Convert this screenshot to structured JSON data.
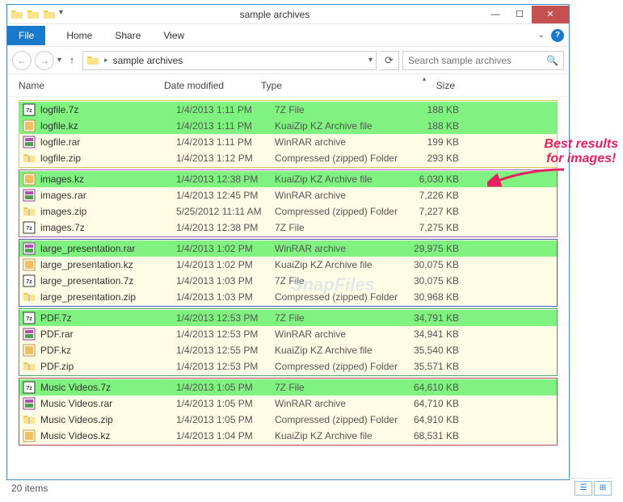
{
  "window": {
    "title": "sample archives"
  },
  "ribbon": {
    "file": "File",
    "home": "Home",
    "share": "Share",
    "view": "View"
  },
  "breadcrumb": {
    "current": "sample archives"
  },
  "search": {
    "placeholder": "Search sample archives"
  },
  "columns": {
    "name": "Name",
    "date": "Date modified",
    "type": "Type",
    "size": "Size"
  },
  "groups": [
    {
      "cls": "grp-yellow",
      "rows": [
        {
          "hl": "green",
          "icon": "7z",
          "name": "logfile.7z",
          "date": "1/4/2013 1:11 PM",
          "type": "7Z File",
          "size": "188 KB"
        },
        {
          "hl": "green",
          "icon": "kz",
          "name": "logfile.kz",
          "date": "1/4/2013 1:11 PM",
          "type": "KuaiZip KZ Archive file",
          "size": "188 KB"
        },
        {
          "hl": "yellow",
          "icon": "rar",
          "name": "logfile.rar",
          "date": "1/4/2013 1:11 PM",
          "type": "WinRAR archive",
          "size": "199 KB"
        },
        {
          "hl": "yellow",
          "icon": "zip",
          "name": "logfile.zip",
          "date": "1/4/2013 1:12 PM",
          "type": "Compressed (zipped) Folder",
          "size": "293 KB"
        }
      ]
    },
    {
      "cls": "grp-purple",
      "rows": [
        {
          "hl": "green",
          "icon": "kz",
          "name": "images.kz",
          "date": "1/4/2013 12:38 PM",
          "type": "KuaiZip KZ Archive file",
          "size": "6,030 KB"
        },
        {
          "hl": "yellow",
          "icon": "rar",
          "name": "images.rar",
          "date": "1/4/2013 12:45 PM",
          "type": "WinRAR archive",
          "size": "7,226 KB"
        },
        {
          "hl": "yellow",
          "icon": "zip",
          "name": "images.zip",
          "date": "5/25/2012 11:11 AM",
          "type": "Compressed (zipped) Folder",
          "size": "7,227 KB"
        },
        {
          "hl": "yellow",
          "icon": "7z",
          "name": "images.7z",
          "date": "1/4/2013 12:38 PM",
          "type": "7Z File",
          "size": "7,275 KB"
        }
      ]
    },
    {
      "cls": "grp-blue",
      "rows": [
        {
          "hl": "green",
          "icon": "rar",
          "name": "large_presentation.rar",
          "date": "1/4/2013 1:02 PM",
          "type": "WinRAR archive",
          "size": "29,975 KB"
        },
        {
          "hl": "yellow",
          "icon": "kz",
          "name": "large_presentation.kz",
          "date": "1/4/2013 1:02 PM",
          "type": "KuaiZip KZ Archive file",
          "size": "30,075 KB"
        },
        {
          "hl": "yellow",
          "icon": "7z",
          "name": "large_presentation.7z",
          "date": "1/4/2013 1:03 PM",
          "type": "7Z File",
          "size": "30,075 KB"
        },
        {
          "hl": "yellow",
          "icon": "zip",
          "name": "large_presentation.zip",
          "date": "1/4/2013 1:03 PM",
          "type": "Compressed (zipped) Folder",
          "size": "30,968 KB"
        }
      ]
    },
    {
      "cls": "grp-green",
      "rows": [
        {
          "hl": "green",
          "icon": "7z",
          "name": "PDF.7z",
          "date": "1/4/2013 12:53 PM",
          "type": "7Z File",
          "size": "34,791 KB"
        },
        {
          "hl": "yellow",
          "icon": "rar",
          "name": "PDF.rar",
          "date": "1/4/2013 12:53 PM",
          "type": "WinRAR archive",
          "size": "34,941 KB"
        },
        {
          "hl": "yellow",
          "icon": "kz",
          "name": "PDF.kz",
          "date": "1/4/2013 12:55 PM",
          "type": "KuaiZip KZ Archive file",
          "size": "35,540 KB"
        },
        {
          "hl": "yellow",
          "icon": "zip",
          "name": "PDF.zip",
          "date": "1/4/2013 12:53 PM",
          "type": "Compressed (zipped) Folder",
          "size": "35,571 KB"
        }
      ]
    },
    {
      "cls": "grp-red",
      "rows": [
        {
          "hl": "green",
          "icon": "7z",
          "name": "Music Videos.7z",
          "date": "1/4/2013 1:05 PM",
          "type": "7Z File",
          "size": "64,610 KB"
        },
        {
          "hl": "yellow",
          "icon": "rar",
          "name": "Music Videos.rar",
          "date": "1/4/2013 1:05 PM",
          "type": "WinRAR archive",
          "size": "64,710 KB"
        },
        {
          "hl": "yellow",
          "icon": "zip",
          "name": "Music Videos.zip",
          "date": "1/4/2013 1:05 PM",
          "type": "Compressed (zipped) Folder",
          "size": "64,910 KB"
        },
        {
          "hl": "yellow",
          "icon": "kz",
          "name": "Music Videos.kz",
          "date": "1/4/2013 1:04 PM",
          "type": "KuaiZip KZ Archive file",
          "size": "68,531 KB"
        }
      ]
    }
  ],
  "status": {
    "count": "20 items"
  },
  "annotation": {
    "line1": "Best results",
    "line2": "for images!"
  },
  "watermark": "SnapFiles"
}
